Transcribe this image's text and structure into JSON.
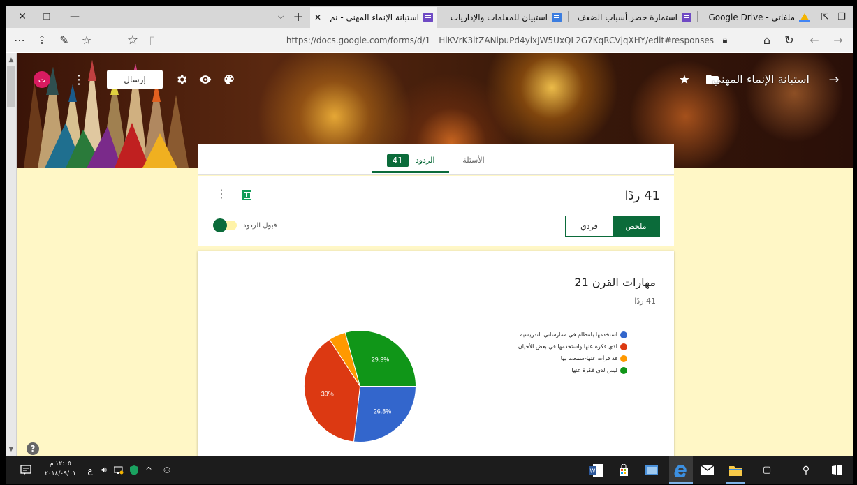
{
  "browser": {
    "tabs": [
      {
        "title": "استبانة الإنماء المهني - نم",
        "active": true,
        "icon": "form-icon"
      },
      {
        "title": "استبيان للمعلمات والإداريات",
        "active": false,
        "icon": "doc-icon"
      },
      {
        "title": "استمارة حصر أسباب الضعف",
        "active": false,
        "icon": "form-icon"
      },
      {
        "title": "ملفاتي - Google Drive",
        "active": false,
        "icon": "drive-icon"
      }
    ],
    "url": "https://docs.google.com/forms/d/1__HlKVrK3ltZANipuPd4yixJW5UxQL2G7KqRCVjqXHY/edit#responses"
  },
  "form": {
    "title": "استبانة الإنماء المهني",
    "send_label": "إرسال",
    "avatar_letter": "ت",
    "tabs": {
      "questions_label": "الأسئلة",
      "responses_label": "الردود",
      "responses_count": "41"
    }
  },
  "summary": {
    "count_title": "41 ردًا",
    "summary_label": "ملخص",
    "individual_label": "فردي",
    "accepting_label": "قبول الردود",
    "accepting_on": true
  },
  "question": {
    "title": "مهارات القرن 21",
    "count": "41 ردًا"
  },
  "chart_data": {
    "type": "pie",
    "categories": [
      "استخدمها بانتظام في ممارساتي التدريسية",
      "لدي فكرة عنها واستخدمها في بعض الأحيان",
      "قد قرأت عنها-سمعت بها",
      "ليس لدي فكرة عنها"
    ],
    "values": [
      26.8,
      39,
      4.9,
      29.3
    ],
    "labels": [
      "26.8%",
      "39%",
      "",
      "29.3%"
    ],
    "colors": [
      "#3366cc",
      "#dc3912",
      "#ff9900",
      "#109618"
    ]
  },
  "taskbar": {
    "time": "١٢:٠٥ م",
    "date": "٢٠١٨/٠٩/٠١",
    "lang": "ع"
  },
  "colors": {
    "brand": "#0b6b3a",
    "background": "#fff7c6"
  }
}
